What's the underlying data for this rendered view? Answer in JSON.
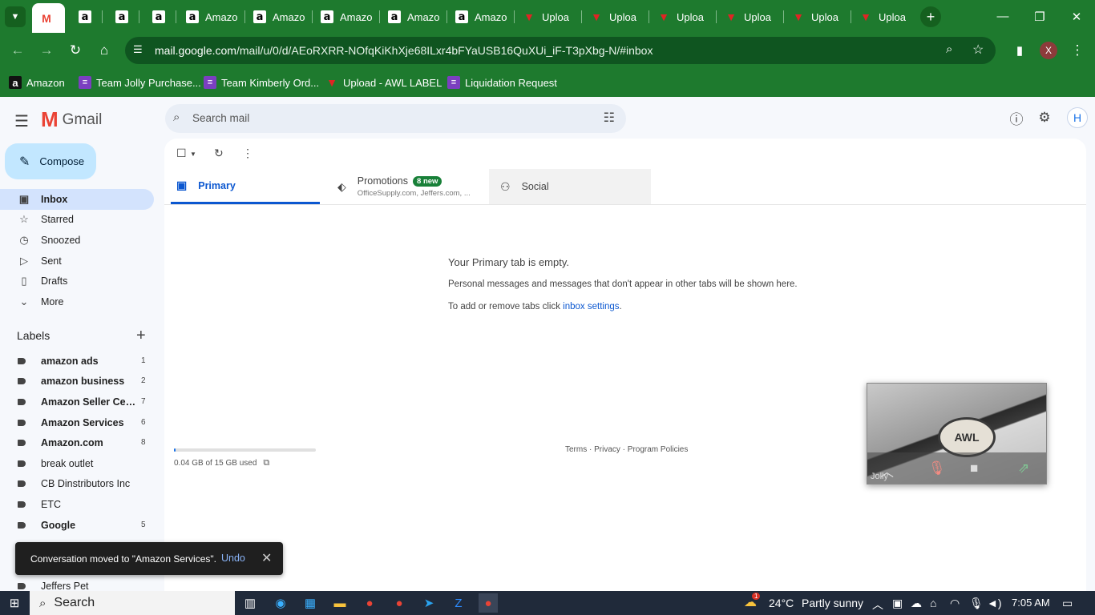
{
  "browser": {
    "tabs": [
      {
        "label": "",
        "icon": "gmail-icon"
      },
      {
        "label": "",
        "icon": "amazon-icon"
      },
      {
        "label": "",
        "icon": "amazon-icon"
      },
      {
        "label": "",
        "icon": "amazon-icon"
      },
      {
        "label": "Amazo",
        "icon": "amazon-icon"
      },
      {
        "label": "Amazo",
        "icon": "amazon-icon"
      },
      {
        "label": "Amazo",
        "icon": "amazon-icon"
      },
      {
        "label": "Amazo",
        "icon": "amazon-icon"
      },
      {
        "label": "Amazo",
        "icon": "amazon-icon"
      },
      {
        "label": "Uploa",
        "icon": "awl-icon"
      },
      {
        "label": "Uploa",
        "icon": "awl-icon"
      },
      {
        "label": "Uploa",
        "icon": "awl-icon"
      },
      {
        "label": "Uploa",
        "icon": "awl-icon"
      },
      {
        "label": "Uploa",
        "icon": "awl-icon"
      },
      {
        "label": "Uploa",
        "icon": "awl-icon"
      }
    ],
    "url_host": "mail.google.com",
    "url_path": "/mail/u/0/d/AEoRXRR-NOfqKiKhXje68ILxr4bFYaUSB16QuXUi_iF-T3pXbg-N/#inbox",
    "profile_initial": "X",
    "bookmarks": [
      {
        "label": "Amazon",
        "icon": "amazon-icon"
      },
      {
        "label": "Team Jolly Purchase...",
        "icon": "forms-icon"
      },
      {
        "label": "Team Kimberly Ord...",
        "icon": "forms-icon"
      },
      {
        "label": "Upload - AWL LABEL",
        "icon": "awl-icon"
      },
      {
        "label": "Liquidation Request",
        "icon": "forms-icon"
      }
    ]
  },
  "gmail": {
    "app_name": "Gmail",
    "compose_label": "Compose",
    "search_placeholder": "Search mail",
    "avatar_initial": "H",
    "nav": [
      {
        "label": "Inbox",
        "icon": "inbox-icon",
        "active": true
      },
      {
        "label": "Starred",
        "icon": "star-icon"
      },
      {
        "label": "Snoozed",
        "icon": "clock-icon"
      },
      {
        "label": "Sent",
        "icon": "send-icon"
      },
      {
        "label": "Drafts",
        "icon": "draft-icon"
      },
      {
        "label": "More",
        "icon": "chevron-down-icon"
      }
    ],
    "labels_heading": "Labels",
    "labels": [
      {
        "name": "amazon ads",
        "count": "1",
        "bold": true
      },
      {
        "name": "amazon business",
        "count": "2",
        "bold": true
      },
      {
        "name": "Amazon Seller Cen...",
        "count": "7",
        "bold": true
      },
      {
        "name": "Amazon Services",
        "count": "6",
        "bold": true
      },
      {
        "name": "Amazon.com",
        "count": "8",
        "bold": true
      },
      {
        "name": "break outlet",
        "count": "",
        "bold": false
      },
      {
        "name": "CB Dinstributors Inc",
        "count": "",
        "bold": false
      },
      {
        "name": "ETC",
        "count": "",
        "bold": false
      },
      {
        "name": "Google",
        "count": "5",
        "bold": true
      },
      {
        "name": "Jeffers Pet",
        "count": "",
        "bold": false
      }
    ],
    "tabs": {
      "primary": "Primary",
      "promotions": "Promotions",
      "promotions_badge": "8 new",
      "promotions_senders": "OfficeSupply.com, Jeffers.com, ...",
      "social": "Social"
    },
    "empty": {
      "title": "Your Primary tab is empty.",
      "description": "Personal messages and messages that don't appear in other tabs will be shown here.",
      "hint_prefix": "To add or remove tabs click ",
      "hint_link": "inbox settings",
      "hint_suffix": "."
    },
    "storage": {
      "text": "0.04 GB of 15 GB used",
      "used_fraction": 0.003
    },
    "footer": "Terms · Privacy · Program Policies",
    "meet": {
      "participant": "Jolly",
      "logo_text": "AWL"
    },
    "snackbar": {
      "message": "Conversation moved to \"Amazon Services\".",
      "action": "Undo"
    }
  },
  "taskbar": {
    "search_label": "Search",
    "weather_temp": "24°C",
    "weather_text": "Partly sunny",
    "weather_badge": "1",
    "time": "7:05 AM"
  },
  "colors": {
    "browser_green": "#1e7a2e",
    "gmail_bg": "#f6f8fc",
    "accent_blue": "#0b57d0",
    "compose_bg": "#c2e7ff"
  }
}
